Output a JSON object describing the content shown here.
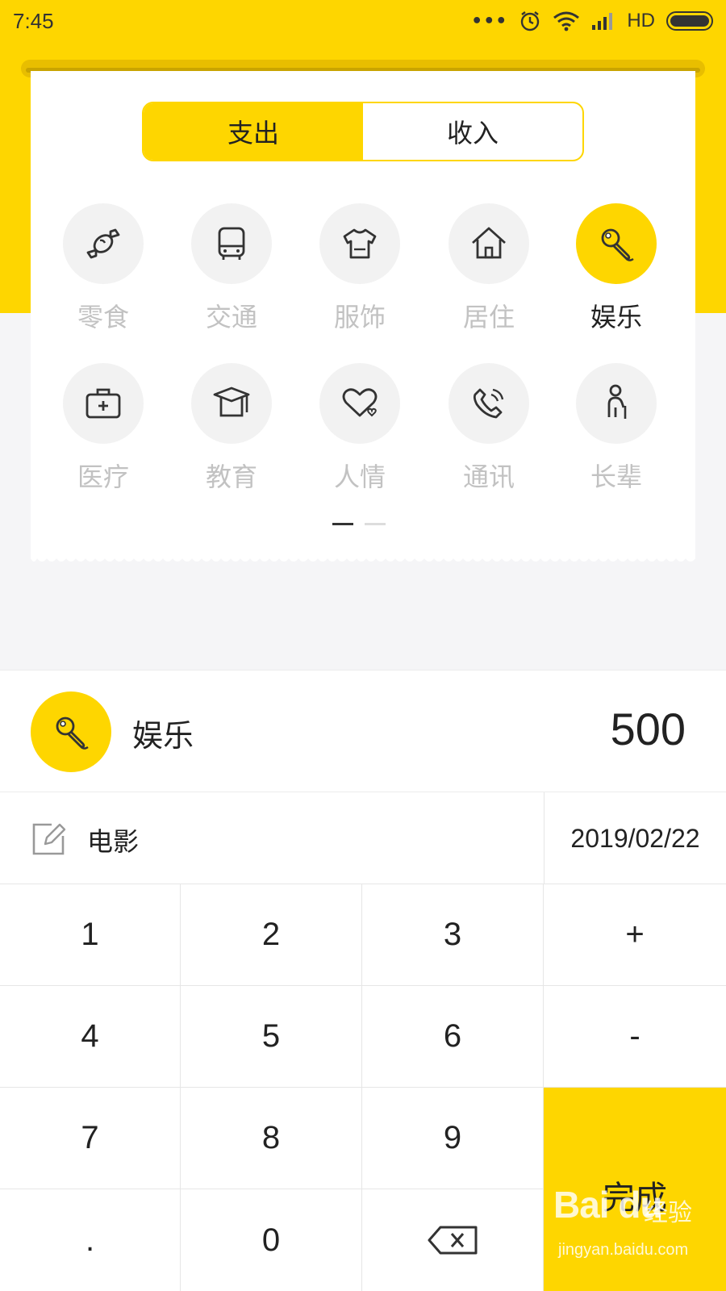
{
  "status_bar": {
    "time": "7:45",
    "dots": "•••",
    "network": "HD"
  },
  "toggle": {
    "expense": "支出",
    "income": "收入",
    "active": "expense"
  },
  "categories": [
    {
      "label": "零食",
      "icon": "candy-icon",
      "selected": false
    },
    {
      "label": "交通",
      "icon": "bus-icon",
      "selected": false
    },
    {
      "label": "服饰",
      "icon": "shirt-icon",
      "selected": false
    },
    {
      "label": "居住",
      "icon": "house-icon",
      "selected": false
    },
    {
      "label": "娱乐",
      "icon": "microphone-icon",
      "selected": true
    },
    {
      "label": "医疗",
      "icon": "medical-kit-icon",
      "selected": false
    },
    {
      "label": "教育",
      "icon": "graduation-cap-icon",
      "selected": false
    },
    {
      "label": "人情",
      "icon": "heart-icon",
      "selected": false
    },
    {
      "label": "通讯",
      "icon": "phone-icon",
      "selected": false
    },
    {
      "label": "长辈",
      "icon": "elder-icon",
      "selected": false
    }
  ],
  "pager": {
    "pages": 2,
    "current": 1
  },
  "summary": {
    "category": "娱乐",
    "amount": "500"
  },
  "note": {
    "text": "电影",
    "date": "2019/02/22"
  },
  "keypad": {
    "keys": [
      "1",
      "2",
      "3",
      "+",
      "4",
      "5",
      "6",
      "-",
      "7",
      "8",
      "9",
      ".",
      "0"
    ],
    "done": "完成",
    "backspace_icon": "backspace-icon"
  },
  "watermark": {
    "logo": "Bai du",
    "brand": "经验",
    "url": "jingyan.baidu.com"
  },
  "colors": {
    "accent": "#FED600",
    "text": "#222222",
    "muted": "#C2C2C2"
  }
}
